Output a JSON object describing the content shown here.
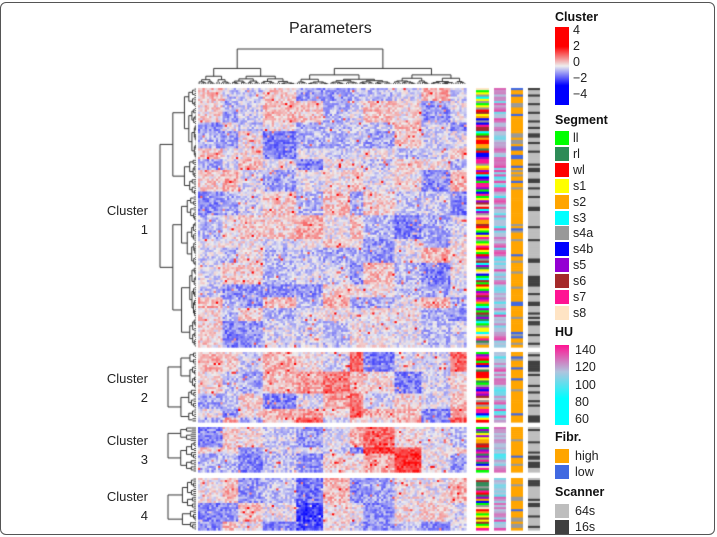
{
  "chart_data": {
    "type": "heatmap",
    "title": "Parameters",
    "row_groups": [
      {
        "label": "Cluster",
        "number": "1",
        "rows": 120
      },
      {
        "label": "Cluster",
        "number": "2",
        "rows": 32
      },
      {
        "label": "Cluster",
        "number": "3",
        "rows": 22
      },
      {
        "label": "Cluster",
        "number": "4",
        "rows": 25
      }
    ],
    "n_columns": 120,
    "column_dendrogram": true,
    "row_dendrogram": true,
    "annotation_columns": [
      "Segment",
      "HU",
      "Fibr.",
      "Scanner"
    ],
    "legends": {
      "cluster": {
        "title": "Cluster",
        "type": "continuous",
        "range": [
          -4,
          4
        ],
        "ticks": [
          "4",
          "2",
          "0",
          "−2",
          "−4"
        ],
        "colors": {
          "low": "#0000ff",
          "mid": "#eeeeee",
          "high": "#ff0000"
        }
      },
      "segment": {
        "title": "Segment",
        "type": "categorical",
        "items": [
          {
            "label": "ll",
            "color": "#00ff00"
          },
          {
            "label": "rl",
            "color": "#2e8b57"
          },
          {
            "label": "wl",
            "color": "#ff0000"
          },
          {
            "label": "s1",
            "color": "#ffff00"
          },
          {
            "label": "s2",
            "color": "#ffa500"
          },
          {
            "label": "s3",
            "color": "#00ffff"
          },
          {
            "label": "s4a",
            "color": "#999999"
          },
          {
            "label": "s4b",
            "color": "#0000ff"
          },
          {
            "label": "s5",
            "color": "#9400d3"
          },
          {
            "label": "s6",
            "color": "#a52a2a"
          },
          {
            "label": "s7",
            "color": "#ff1493"
          },
          {
            "label": "s8",
            "color": "#ffe4c4"
          }
        ]
      },
      "hu": {
        "title": "HU",
        "type": "continuous",
        "range": [
          60,
          140
        ],
        "ticks": [
          "140",
          "120",
          "100",
          "80",
          "60"
        ],
        "colors": {
          "low": "#00ffff",
          "mid": "#b0c4de",
          "high": "#ff1493"
        }
      },
      "fibr": {
        "title": "Fibr.",
        "type": "categorical",
        "items": [
          {
            "label": "high",
            "color": "#ffa500"
          },
          {
            "label": "low",
            "color": "#4169e1"
          }
        ]
      },
      "scanner": {
        "title": "Scanner",
        "type": "categorical",
        "items": [
          {
            "label": "64s",
            "color": "#bebebe"
          },
          {
            "label": "16s",
            "color": "#404040"
          }
        ]
      }
    }
  }
}
